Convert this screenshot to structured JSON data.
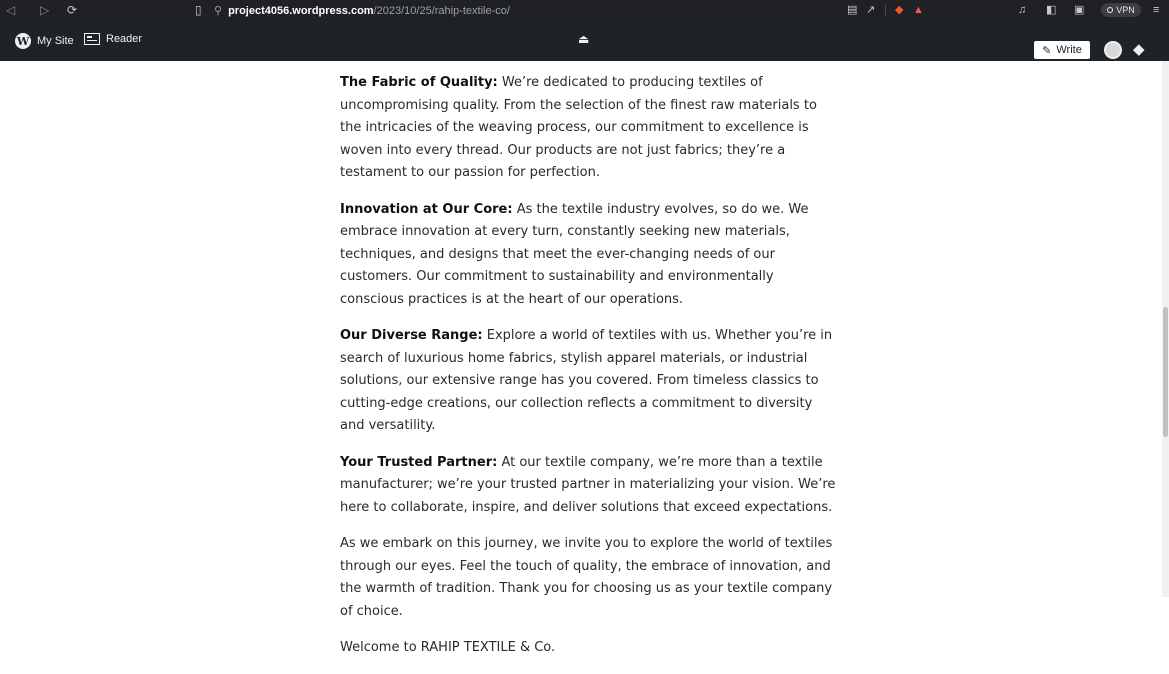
{
  "browser": {
    "url_host": "project4056.wordpress.com",
    "url_path": "/2023/10/25/rahip-textile-co/",
    "vpn_label": "VPN",
    "icons": [
      "back-icon",
      "forward-icon",
      "reload-icon",
      "bookmark-icon",
      "site-settings-icon",
      "reader-mode-icon",
      "share-icon",
      "brave-shields-icon",
      "brave-rewards-icon",
      "media-icon",
      "sidebar-icon",
      "wallet-icon",
      "vpn-icon",
      "menu-icon"
    ]
  },
  "admin_bar": {
    "my_site": "My Site",
    "reader": "Reader",
    "write": "Write"
  },
  "article": {
    "paragraphs": [
      {
        "lead": "The Fabric of Quality:",
        "text": " We’re dedicated to producing textiles of uncompromising quality. From the selection of the finest raw materials to the intricacies of the weaving process, our commitment to excellence is woven into every thread. Our products are not just fabrics; they’re a testament to our passion for perfection."
      },
      {
        "lead": "Innovation at Our Core:",
        "text": " As the textile industry evolves, so do we. We embrace innovation at every turn, constantly seeking new materials, techniques, and designs that meet the ever-changing needs of our customers. Our commitment to sustainability and environmentally conscious practices is at the heart of our operations."
      },
      {
        "lead": "Our Diverse Range:",
        "text": " Explore a world of textiles with us. Whether you’re in search of luxurious home fabrics, stylish apparel materials, or industrial solutions, our extensive range has you covered. From timeless classics to cutting-edge creations, our collection reflects a commitment to diversity and versatility."
      },
      {
        "lead": "Your Trusted Partner:",
        "text": " At our textile company, we’re more than a textile manufacturer; we’re your trusted partner in materializing your vision. We’re here to collaborate, inspire, and deliver solutions that exceed expectations."
      },
      {
        "lead": "",
        "text": "As we embark on this journey, we invite you to explore the world of textiles through our eyes. Feel the touch of quality, the embrace of innovation, and the warmth of tradition. Thank you for choosing us as your textile company of choice."
      },
      {
        "lead": "",
        "text": "Welcome to RAHIP TEXTILE & Co."
      }
    ]
  }
}
